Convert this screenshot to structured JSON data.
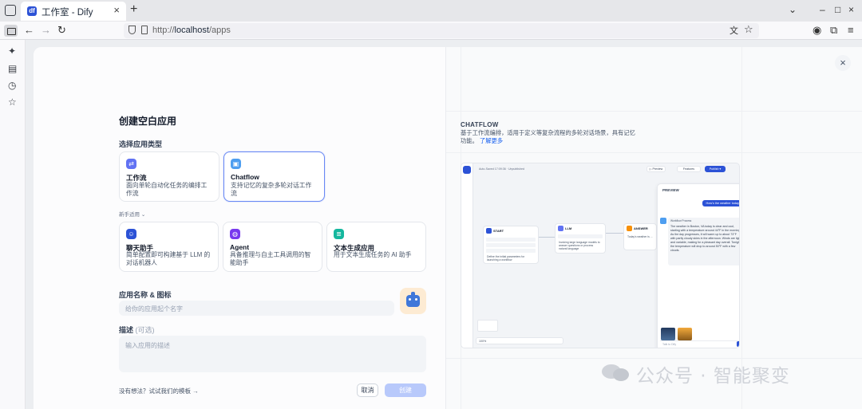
{
  "browser": {
    "tab_title": "工作室 - Dify",
    "tab_favicon_text": "df",
    "new_tab": "+",
    "url_prefix": "http://",
    "url_host": "localhost",
    "url_path": "/apps",
    "icons": [
      "tablist-icon",
      "close-icon",
      "new-tab-icon",
      "chevron-down-icon",
      "minimize-icon",
      "maximize-icon",
      "window-close-icon",
      "sidebar-toggle-icon",
      "back-icon",
      "forward-icon",
      "reload-icon",
      "shield-icon",
      "page-icon",
      "translate-icon",
      "bookmark-star-icon",
      "account-icon",
      "extensions-icon",
      "menu-icon"
    ]
  },
  "sidebar": {
    "icons": [
      "ai-sparkle-icon",
      "tabs-icon",
      "history-icon",
      "bookmarks-icon"
    ]
  },
  "form": {
    "heading": "创建空白应用",
    "type_label": "选择应用类型",
    "cards_primary": [
      {
        "title": "工作流",
        "desc": "面向单轮自动化任务的编排工作流",
        "color": "#6172f3"
      },
      {
        "title": "Chatflow",
        "desc": "支持记忆的复杂多轮对话工作流",
        "color": "#4e9ef0"
      }
    ],
    "beginner_label": "新手适用",
    "cards_beginner": [
      {
        "title": "聊天助手",
        "desc": "简单配置即可构建基于 LLM 的对话机器人",
        "color": "#2c52d6"
      },
      {
        "title": "Agent",
        "desc": "具备推理与自主工具调用的智能助手",
        "color": "#7839ee"
      },
      {
        "title": "文本生成应用",
        "desc": "用于文本生成任务的 AI 助手",
        "color": "#15b79e"
      }
    ],
    "name_label": "应用名称 & 图标",
    "name_placeholder": "给你的应用起个名字",
    "desc_label": "描述",
    "desc_optional": "(可选)",
    "desc_placeholder": "输入应用的描述",
    "template_link": "没有想法？试试我们的模板 →",
    "cancel": "取消",
    "create": "创建"
  },
  "preview": {
    "close": "×",
    "title": "CHATFLOW",
    "desc": "基于工作流编排，适用于定义等复杂流程的多轮对话场景，具有记忆功能。",
    "learn_more": "了解更多",
    "mock": {
      "topbar_text": "Auto-Saved 17:09:36 · Unpublished",
      "preview_btn": "▷ Preview",
      "features_btn": "Features",
      "publish_btn": "Publish ▾",
      "nodes": [
        {
          "title": "START",
          "desc": "Define the initial parameters for launching a workflow"
        },
        {
          "title": "LLM",
          "desc": "Invoking large language models to answer questions or process natural language"
        },
        {
          "title": "ANSWER",
          "desc": "Today's weather is ..."
        }
      ],
      "chat_title": "PREVIEW",
      "user_msg": "How's the weather today",
      "workflow_label": "Workflow Process",
      "bot_msg": "The weather in Boston, VA today is clear and cool, starting with a temperature around 44°F in the morning. As the day progresses, it will warm up to about 73°F with partly cloudy skies in the afternoon. Winds are light and variable, making for a pleasant day overall. Tonight, the temperature will drop to around 50°F with a few clouds.",
      "chat_placeholder": "Talk to Dify",
      "zoom": "100%"
    }
  },
  "watermark": "公众号 · 智能聚变"
}
